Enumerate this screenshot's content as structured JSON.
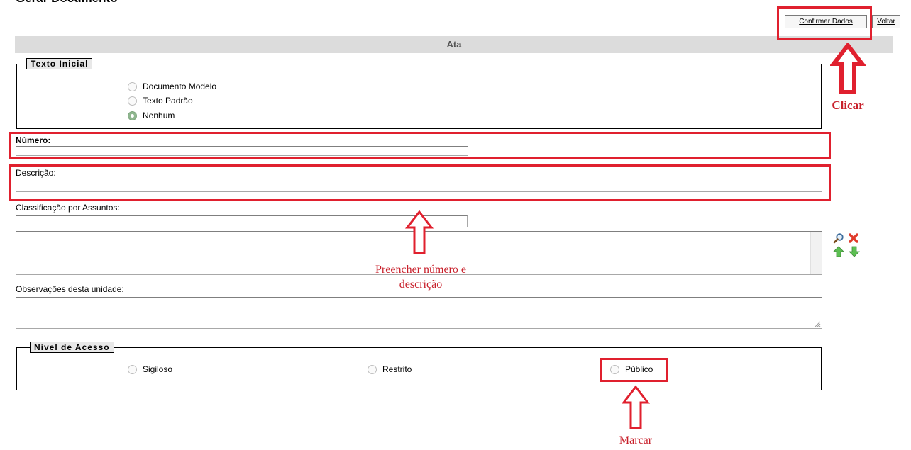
{
  "page": {
    "title": "Gerar Documento"
  },
  "toolbar": {
    "confirm_label": "Confirmar Dados",
    "back_label": "Voltar"
  },
  "section": {
    "title": "Ata"
  },
  "texto_inicial": {
    "legend": "Texto Inicial",
    "options": [
      {
        "label": "Documento Modelo",
        "checked": false
      },
      {
        "label": "Texto Padrão",
        "checked": false
      },
      {
        "label": "Nenhum",
        "checked": true
      }
    ]
  },
  "numero": {
    "label": "Número:",
    "value": ""
  },
  "descricao": {
    "label": "Descrição:",
    "value": ""
  },
  "classificacao": {
    "label": "Classificação por Assuntos:",
    "value": ""
  },
  "observacoes": {
    "label": "Observações desta unidade:",
    "value": ""
  },
  "nivel_acesso": {
    "legend": "Nível de Acesso",
    "options": [
      {
        "label": "Sigiloso",
        "checked": false
      },
      {
        "label": "Restrito",
        "checked": false
      },
      {
        "label": "Público",
        "checked": false
      }
    ]
  },
  "icons": [
    "search-icon",
    "remove-icon",
    "move-up-icon",
    "move-down-icon"
  ],
  "annotations": {
    "clicar": "Clicar",
    "preencher_line1": "Preencher número e",
    "preencher_line2": "descrição",
    "marcar": "Marcar"
  },
  "colors": {
    "annotation_red": "#e0202e",
    "section_bar": "#dcdcdc"
  }
}
